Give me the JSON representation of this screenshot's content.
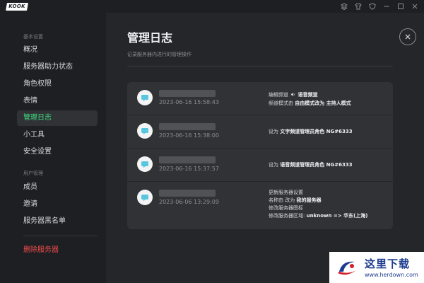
{
  "app": {
    "logo_text": "KOOK"
  },
  "window_controls": [
    "stack-icon",
    "shirt-icon",
    "shield-icon",
    "minimize-icon",
    "maximize-icon",
    "close-icon"
  ],
  "sidebar": {
    "section_basic": "基本设置",
    "items_basic": [
      {
        "label": "概况"
      },
      {
        "label": "服务器助力状态"
      },
      {
        "label": "角色权限"
      },
      {
        "label": "表情"
      },
      {
        "label": "管理日志",
        "active": true
      },
      {
        "label": "小工具"
      },
      {
        "label": "安全设置"
      }
    ],
    "section_users": "用户管理",
    "items_users": [
      {
        "label": "成员"
      },
      {
        "label": "邀请"
      },
      {
        "label": "服务器黑名单"
      }
    ],
    "delete_label": "删除服务器"
  },
  "main": {
    "title": "管理日志",
    "subtitle": "记录服务器内进行的管理操作"
  },
  "logs": [
    {
      "time": "2023-06-16 15:58:43",
      "lines": [
        {
          "pre": "编辑频道",
          "bold": "语音频道",
          "icon": "speaker-icon"
        },
        {
          "pre": "频道模式由 ",
          "bold": "自由模式改为 主持人模式"
        }
      ]
    },
    {
      "time": "2023-06-16 15:38:00",
      "lines": [
        {
          "pre": "设为 ",
          "bold": "文字频道管理员角色   NG#6333"
        }
      ]
    },
    {
      "time": "2023-06-16 15:37:57",
      "lines": [
        {
          "pre": "设为 ",
          "bold": "语音频道管理员角色   NG#6333"
        }
      ]
    },
    {
      "time": "2023-06-06 13:29:09",
      "lines": [
        {
          "pre": "更新服务器设置",
          "bold": ""
        },
        {
          "pre": "名称由 改为 ",
          "bold": "我的服务器"
        },
        {
          "pre": "修改服务器图标",
          "bold": ""
        },
        {
          "pre": "修改服务器区域:  ",
          "bold": "unknown  =>  华东(上海)"
        }
      ]
    }
  ],
  "watermark": {
    "title": "这里下载",
    "url": "www.herdown.com"
  },
  "colors": {
    "accent_green": "#3fd97e",
    "danger_red": "#f14c4c",
    "panel_bg": "#303236",
    "main_bg": "#25262a",
    "sidebar_bg": "#1e1f22",
    "watermark_blue": "#1d3c8f"
  }
}
